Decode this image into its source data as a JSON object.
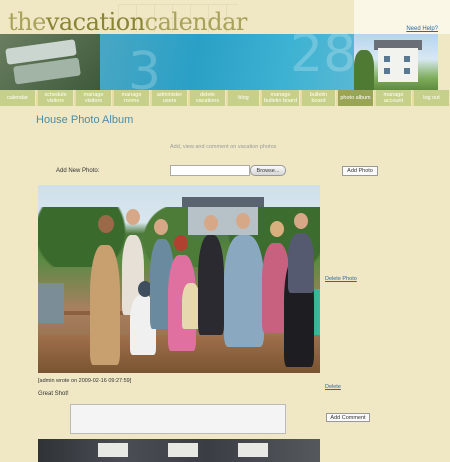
{
  "header": {
    "logo_the": "the",
    "logo_vacation": "vacation",
    "logo_calendar": "calendar",
    "help_link": "Need Help?",
    "banner_numbers": [
      "3",
      "28"
    ]
  },
  "nav": {
    "items": [
      {
        "label": "calendar"
      },
      {
        "label": "schedule visitors"
      },
      {
        "label": "manage visitors"
      },
      {
        "label": "manage rooms"
      },
      {
        "label": "administer users"
      },
      {
        "label": "delete vacations"
      },
      {
        "label": "blog"
      },
      {
        "label": "manage bulletin board"
      },
      {
        "label": "bulletin board"
      },
      {
        "label": "photo album",
        "active": true
      },
      {
        "label": "manage account"
      },
      {
        "label": "log out"
      }
    ]
  },
  "main": {
    "title": "House Photo Album",
    "subtitle": "Add, view and comment on vacation photos",
    "add_new_label": "Add New Photo:",
    "browse_label": "Browse...",
    "add_photo_label": "Add Photo",
    "delete_photo_label": "Delete Photo",
    "comment": {
      "meta": "[admin wrote on 2009-02-16 09:27:59]",
      "text": "Great Shot!",
      "delete_label": "Delete"
    },
    "add_comment_label": "Add Comment"
  },
  "colors": {
    "page_bg": "#f0e8c4",
    "nav_bg": "#c7d08a",
    "nav_active": "#9aa455",
    "title": "#4a8da8",
    "link": "#2a6aa0"
  }
}
